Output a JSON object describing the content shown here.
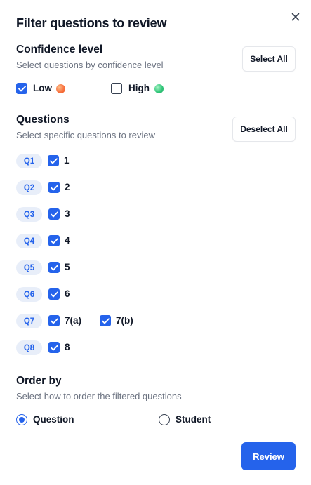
{
  "dialog": {
    "title": "Filter questions to review",
    "close_icon": "close-icon"
  },
  "confidence": {
    "title": "Confidence level",
    "subtitle": "Select questions by confidence level",
    "select_all_label": "Select All",
    "options": [
      {
        "label": "Low",
        "checked": false
      },
      {
        "label": "High",
        "checked": false
      }
    ],
    "colors": {
      "low": "#f97341",
      "high": "#34c77b"
    }
  },
  "questions": {
    "title": "Questions",
    "subtitle": "Select specific questions to review",
    "deselect_all_label": "Deselect All",
    "rows": [
      {
        "badge": "Q1",
        "parts": [
          {
            "label": "1",
            "checked": true
          }
        ]
      },
      {
        "badge": "Q2",
        "parts": [
          {
            "label": "2",
            "checked": true
          }
        ]
      },
      {
        "badge": "Q3",
        "parts": [
          {
            "label": "3",
            "checked": true
          }
        ]
      },
      {
        "badge": "Q4",
        "parts": [
          {
            "label": "4",
            "checked": true
          }
        ]
      },
      {
        "badge": "Q5",
        "parts": [
          {
            "label": "5",
            "checked": true
          }
        ]
      },
      {
        "badge": "Q6",
        "parts": [
          {
            "label": "6",
            "checked": true
          }
        ]
      },
      {
        "badge": "Q7",
        "parts": [
          {
            "label": "7(a)",
            "checked": true
          },
          {
            "label": "7(b)",
            "checked": true
          }
        ]
      },
      {
        "badge": "Q8",
        "parts": [
          {
            "label": "8",
            "checked": true
          }
        ]
      }
    ]
  },
  "order_by": {
    "title": "Order by",
    "subtitle": "Select how to order the filtered questions",
    "options": [
      {
        "label": "Question",
        "selected": true
      },
      {
        "label": "Student",
        "selected": false
      }
    ]
  },
  "actions": {
    "review_label": "Review"
  },
  "theme": {
    "accent": "#2563eb",
    "badge_bg": "#e8eef9",
    "muted_text": "#6b7280"
  }
}
